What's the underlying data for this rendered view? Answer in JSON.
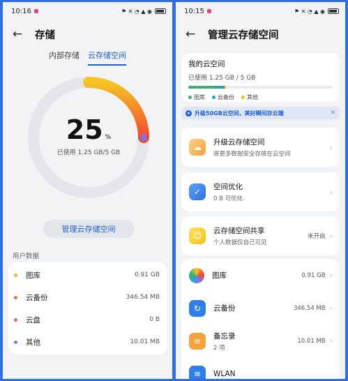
{
  "left": {
    "status": {
      "time": "10:16",
      "icons": "⚑ ✕ ◔ ▲ ◉"
    },
    "title": "存储",
    "tabs": [
      {
        "label": "内部存储"
      },
      {
        "label": "云存储空间"
      }
    ],
    "ring": {
      "percent": "25",
      "percent_sign": "%",
      "used_text": "已使用 1.25 GB/5 GB",
      "fraction": 0.25
    },
    "manage_button": "管理云存储空间",
    "section_label": "用户数据",
    "rows": [
      {
        "label": "图库",
        "size": "0.91 GB",
        "color": "#f0b92a"
      },
      {
        "label": "云备份",
        "size": "346.54 MB",
        "color": "#e8763b"
      },
      {
        "label": "云盘",
        "size": "0 B",
        "color": "#e75a8f"
      },
      {
        "label": "其他",
        "size": "10.01 MB",
        "color": "#8a6fe0"
      }
    ]
  },
  "right": {
    "status": {
      "time": "10:15",
      "icons": "⚑ ✕ ◔ ▲ ◉"
    },
    "title": "管理云存储空间",
    "cloud": {
      "title": "我的云空间",
      "used": "已使用 1.25 GB / 5 GB",
      "segments": [
        {
          "name": "图库",
          "fraction": 0.18,
          "color": "#36b56a"
        },
        {
          "name": "云备份",
          "fraction": 0.07,
          "color": "#1aa6c0"
        },
        {
          "name": "其他",
          "fraction": 0.01,
          "color": "#f0b92a"
        }
      ]
    },
    "promo": {
      "icon": "★",
      "text": "升级50GB云空间，美好瞬间存云端",
      "close": "✕"
    },
    "upgrade": {
      "title": "升级云存储空间",
      "sub": "将更多数据安全存放在云空间"
    },
    "optimize": {
      "title": "空间优化",
      "sub": "0 B 可优化"
    },
    "share": {
      "title": "云存储空间共享",
      "sub": "个人数据仅自己可见",
      "status": "未开启"
    },
    "apps": [
      {
        "title": "图库",
        "value": "0.91 GB",
        "icon": "gallery-icon"
      },
      {
        "title": "云备份",
        "value": "346.54 MB",
        "icon": "cloud-backup-icon"
      },
      {
        "title": "备忘录",
        "sub": "2 项",
        "value": "10.01 MB",
        "icon": "notes-icon"
      },
      {
        "title": "WLAN",
        "icon": "wlan-icon"
      }
    ],
    "chevron": "›"
  },
  "colors": {
    "accent": "#1e5fd6",
    "ring_start": "#f6c425",
    "ring_end": "#f04b2d",
    "track": "#e4e6ea"
  }
}
